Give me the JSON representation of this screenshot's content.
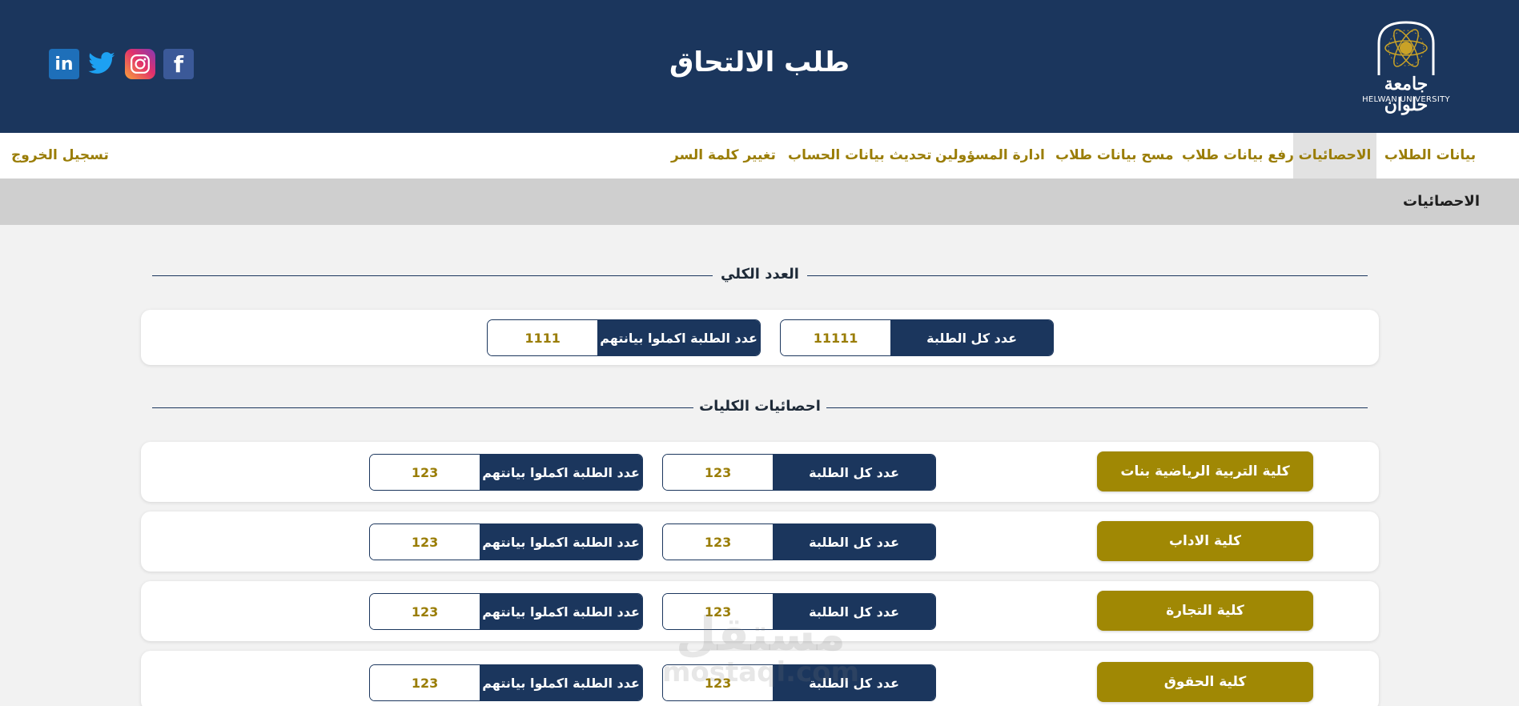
{
  "header": {
    "title": "طلب الالتحاق",
    "logo_arabic": "جامعة حلوان",
    "logo_english": "HELWAN UNIVERSITY",
    "background_color": "#1b365d",
    "social": [
      {
        "icon": "linkedin-icon",
        "text": "in"
      },
      {
        "icon": "twitter-icon"
      },
      {
        "icon": "instagram-icon"
      },
      {
        "icon": "facebook-icon",
        "text": "f"
      }
    ]
  },
  "nav": {
    "items": [
      {
        "label": "بيانات الطلاب",
        "active": false
      },
      {
        "label": "الاحصائيات",
        "active": true
      },
      {
        "label": "رفع بيانات طلاب",
        "active": false
      },
      {
        "label": "مسح بيانات طلاب",
        "active": false
      },
      {
        "label": "ادارة المسؤولين",
        "active": false
      },
      {
        "label": "تحديث بيانات الحساب",
        "active": false
      },
      {
        "label": "تغيير كلمة السر",
        "active": false
      }
    ],
    "logout": "تسجيل الخروج",
    "accent_color": "#9a7d05"
  },
  "breadcrumb": "الاحصائيات",
  "totals": {
    "heading": "العدد الكلي",
    "all_students_label": "عدد كل الطلبة",
    "all_students_value": "11111",
    "completed_label": "عدد الطلبة اكملوا بيانتهم",
    "completed_value": "1111"
  },
  "faculties": {
    "heading": "احصائيات الكليات",
    "all_students_label": "عدد كل الطلبة",
    "completed_label": "عدد الطلبة اكملوا بيانتهم",
    "rows": [
      {
        "name": "كلية التربية الرياضية بنات",
        "all": "123",
        "completed": "123"
      },
      {
        "name": "كلية الاداب",
        "all": "123",
        "completed": "123"
      },
      {
        "name": "كلية التجارة",
        "all": "123",
        "completed": "123"
      },
      {
        "name": "كلية الحقوق",
        "all": "123",
        "completed": "123"
      }
    ],
    "faculty_color": "#a08804"
  },
  "watermark": {
    "arabic": "مستقل",
    "english": "mostaql.com"
  }
}
